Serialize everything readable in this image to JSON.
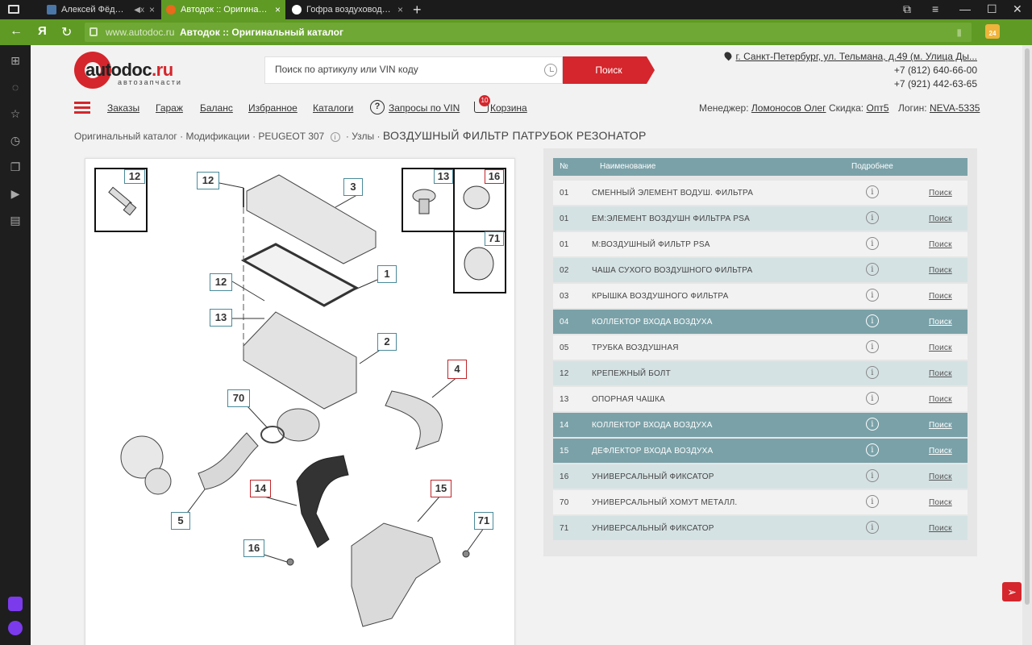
{
  "browser": {
    "tabs": [
      {
        "title": "Алексей Фёдоров",
        "favicon_color": "#4a76a8",
        "close": "×",
        "mute": "◀x"
      },
      {
        "title": "Автодок :: Оригинальный",
        "favicon_color": "#e86a1c",
        "close": "×"
      },
      {
        "title": "Гофра воздуховода для Р",
        "favicon_color": "#ffffff",
        "close": "×"
      }
    ],
    "new_tab": "+",
    "window_controls": [
      "⧉",
      "≡",
      "—",
      "☐",
      "✕"
    ],
    "nav": {
      "back": "←",
      "yandex": "Я",
      "reload": "↻"
    },
    "url_domain": "www.autodoc.ru",
    "url_title": "Автодок :: Оригинальный каталог",
    "bookmark": "▮",
    "ext_badge": "24",
    "sidebar_icons": [
      "grid-icon",
      "bell-icon",
      "star-icon",
      "clock-icon",
      "copy-icon",
      "play-icon",
      "file-icon"
    ]
  },
  "site": {
    "logo_text_main": "autodoc",
    "logo_text_ru": ".ru",
    "logo_sub": "автозапчасти",
    "search_placeholder": "Поиск по артикулу или VIN коду",
    "search_button": "Поиск",
    "address": "г. Санкт-Петербург, ул. Тельмана, д.49 (м. Улица Ды...",
    "phone1": "+7 (812) 640-66-00",
    "phone2": "+7 (921) 442-63-65",
    "nav": [
      "Заказы",
      "Гараж",
      "Баланс",
      "Избранное",
      "Каталоги"
    ],
    "vin_requests": "Запросы по VIN",
    "vin_icon": "?",
    "cart_label": "Корзина",
    "cart_count": "10",
    "manager_label": "Менеджер:",
    "manager_name": "Ломоносов Олег",
    "discount_label": "Скидка:",
    "discount_value": "Опт5",
    "login_label": "Логин:",
    "login_value": "NEVA-5335"
  },
  "breadcrumb": {
    "path1": "Оригинальный каталог · Модификации · PEUGEOT 307",
    "info": "i",
    "path2": "· Узлы ·",
    "title": "ВОЗДУШНЫЙ ФИЛЬТР ПАТРУБОК РЕЗОНАТОР"
  },
  "diagram": {
    "callouts": [
      "12",
      "3",
      "1",
      "12",
      "13",
      "2",
      "4",
      "70",
      "5",
      "14",
      "15",
      "16",
      "71"
    ],
    "inset_callouts": [
      "12",
      "13",
      "16",
      "71"
    ]
  },
  "parts": {
    "headers": {
      "num": "№",
      "name": "Наименование",
      "more": "Подробнее"
    },
    "info_glyph": "i",
    "find_label": "Поиск",
    "rows": [
      {
        "num": "01",
        "name": "СМЕННЫЙ ЭЛЕМЕНТ ВОДУШ. ФИЛЬТРА",
        "highlight": false
      },
      {
        "num": "01",
        "name": "ЕМ:ЭЛЕМЕНТ ВОЗДУШН ФИЛЬТРА PSA",
        "highlight": false
      },
      {
        "num": "01",
        "name": "М:ВОЗДУШНЫЙ ФИЛЬТР PSA",
        "highlight": false
      },
      {
        "num": "02",
        "name": "ЧАША СУХОГО ВОЗДУШНОГО ФИЛЬТРА",
        "highlight": false
      },
      {
        "num": "03",
        "name": "КРЫШКА ВОЗДУШНОГО ФИЛЬТРА",
        "highlight": false
      },
      {
        "num": "04",
        "name": "КОЛЛЕКТОР ВХОДА ВОЗДУХА",
        "highlight": true
      },
      {
        "num": "05",
        "name": "ТРУБКА ВОЗДУШНАЯ",
        "highlight": false
      },
      {
        "num": "12",
        "name": "КРЕПЕЖНЫЙ БОЛТ",
        "highlight": false
      },
      {
        "num": "13",
        "name": "ОПОРНАЯ ЧАШКА",
        "highlight": false
      },
      {
        "num": "14",
        "name": "КОЛЛЕКТОР ВХОДА ВОЗДУХА",
        "highlight": true
      },
      {
        "num": "15",
        "name": "ДЕФЛЕКТОР ВХОДА ВОЗДУХА",
        "highlight": true
      },
      {
        "num": "16",
        "name": "УНИВЕРСАЛЬНЫЙ ФИКСАТОР",
        "highlight": false
      },
      {
        "num": "70",
        "name": "УНИВЕРСАЛЬНЫЙ ХОМУТ МЕТАЛЛ.",
        "highlight": false
      },
      {
        "num": "71",
        "name": "УНИВЕРСАЛЬНЫЙ ФИКСАТОР",
        "highlight": false
      }
    ]
  },
  "feedback_icon": "send-icon",
  "colors": {
    "accent": "#d4262c",
    "browser_green": "#5f9a24",
    "table_teal": "#7aa1a8"
  }
}
